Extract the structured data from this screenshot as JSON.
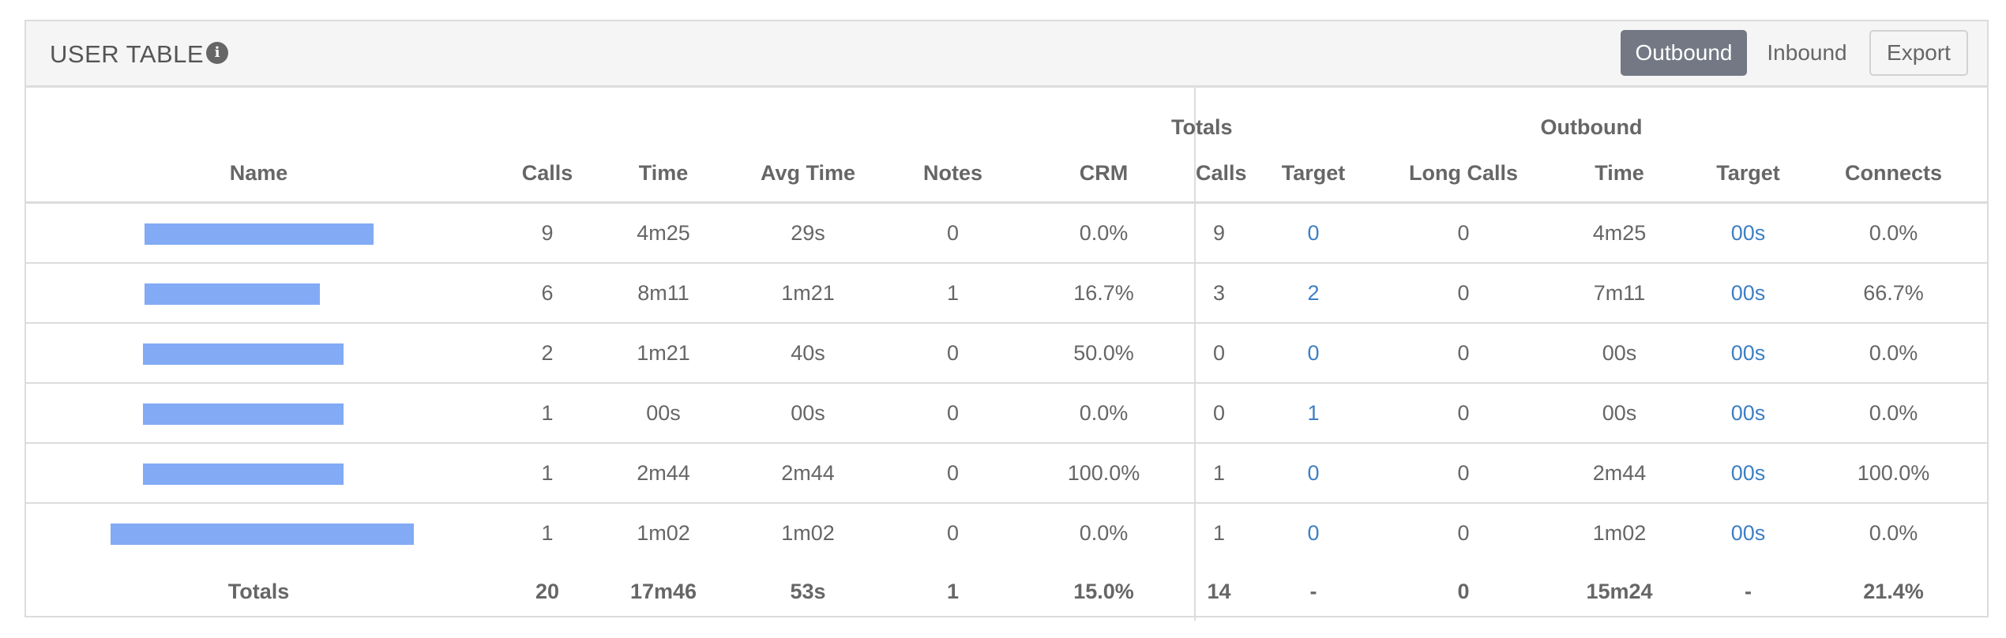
{
  "header": {
    "title": "USER TABLE",
    "info_icon": "info-icon",
    "buttons": {
      "outbound": "Outbound",
      "inbound": "Inbound",
      "export": "Export"
    },
    "active_button": "Outbound",
    "active_color": "#737884"
  },
  "table": {
    "groups": {
      "totals": "Totals",
      "outbound": "Outbound"
    },
    "columns": [
      "Name",
      "Calls",
      "Time",
      "Avg Time",
      "Notes",
      "CRM",
      "Calls",
      "Target",
      "Long Calls",
      "Time",
      "Target",
      "Connects"
    ],
    "rows": [
      {
        "name": "",
        "calls": "9",
        "time": "4m25",
        "avg_time": "29s",
        "notes": "0",
        "crm": "0.0%",
        "out_calls": "9",
        "out_target": "0",
        "long_calls": "0",
        "out_time": "4m25",
        "out_time_target": "00s",
        "connects": "0.0%"
      },
      {
        "name": "",
        "calls": "6",
        "time": "8m11",
        "avg_time": "1m21",
        "notes": "1",
        "crm": "16.7%",
        "out_calls": "3",
        "out_target": "2",
        "long_calls": "0",
        "out_time": "7m11",
        "out_time_target": "00s",
        "connects": "66.7%"
      },
      {
        "name": "",
        "calls": "2",
        "time": "1m21",
        "avg_time": "40s",
        "notes": "0",
        "crm": "50.0%",
        "out_calls": "0",
        "out_target": "0",
        "long_calls": "0",
        "out_time": "00s",
        "out_time_target": "00s",
        "connects": "0.0%"
      },
      {
        "name": "",
        "calls": "1",
        "time": "00s",
        "avg_time": "00s",
        "notes": "0",
        "crm": "0.0%",
        "out_calls": "0",
        "out_target": "1",
        "long_calls": "0",
        "out_time": "00s",
        "out_time_target": "00s",
        "connects": "0.0%"
      },
      {
        "name": "",
        "calls": "1",
        "time": "2m44",
        "avg_time": "2m44",
        "notes": "0",
        "crm": "100.0%",
        "out_calls": "1",
        "out_target": "0",
        "long_calls": "0",
        "out_time": "2m44",
        "out_time_target": "00s",
        "connects": "100.0%"
      },
      {
        "name": "",
        "calls": "1",
        "time": "1m02",
        "avg_time": "1m02",
        "notes": "0",
        "crm": "0.0%",
        "out_calls": "1",
        "out_target": "0",
        "long_calls": "0",
        "out_time": "1m02",
        "out_time_target": "00s",
        "connects": "0.0%"
      }
    ],
    "totals": {
      "label": "Totals",
      "calls": "20",
      "time": "17m46",
      "avg_time": "53s",
      "notes": "1",
      "crm": "15.0%",
      "out_calls": "14",
      "out_target": "-",
      "long_calls": "0",
      "out_time": "15m24",
      "out_time_target": "-",
      "connects": "21.4%"
    }
  },
  "colors": {
    "link": "#3d7fc4",
    "redaction": "#82aaf5"
  }
}
